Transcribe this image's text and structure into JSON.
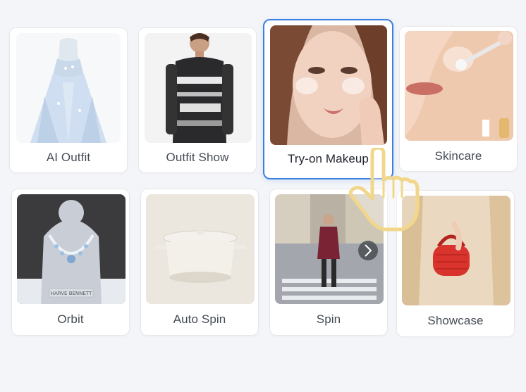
{
  "cards": [
    {
      "label": "AI Outfit",
      "image": "blue-ballgown-dress"
    },
    {
      "label": "Outfit Show",
      "image": "man-patterned-sweater"
    },
    {
      "label": "Try-on Makeup",
      "image": "woman-face-makeup",
      "selected": true
    },
    {
      "label": "Skincare",
      "image": "skincare-applicator-face"
    },
    {
      "label": "Orbit",
      "image": "diamond-necklace-display",
      "plaque_text": "HARVE BENNETT"
    },
    {
      "label": "Auto Spin",
      "image": "white-casserole-pot"
    },
    {
      "label": "Spin",
      "image": "woman-walking-street"
    },
    {
      "label": "Showcase",
      "image": "red-quilted-handbag"
    }
  ],
  "cursor": {
    "icon": "hand-pointer-icon"
  },
  "colors": {
    "selected_border": "#3b7fe0",
    "page_bg": "#f4f5f8"
  }
}
